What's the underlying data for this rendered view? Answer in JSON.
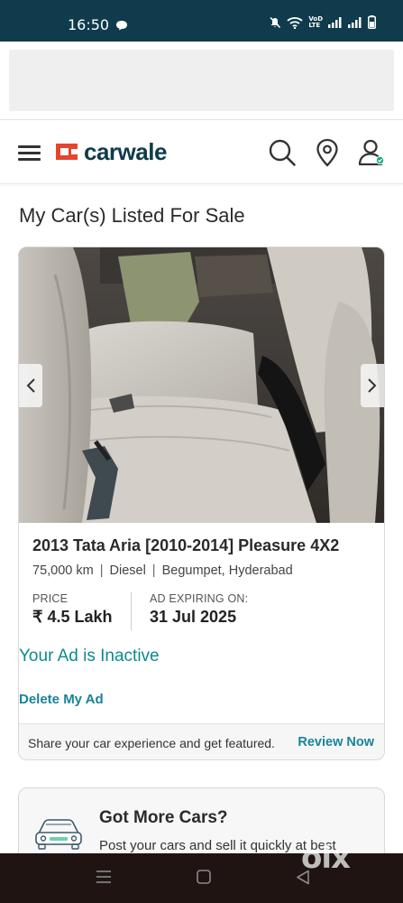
{
  "status_bar": {
    "time": "16:50",
    "network_label_top": "VoD",
    "network_label_bottom": "LTE"
  },
  "header": {
    "logo_text": "carwale",
    "brand_color": "#0f3b4c",
    "logo_accent_color": "#e5452d"
  },
  "page": {
    "title": "My Car(s) Listed For Sale"
  },
  "listing": {
    "title": "2013 Tata Aria [2010-2014] Pleasure 4X2",
    "specs": {
      "kms": "75,000 km",
      "fuel": "Diesel",
      "location": "Begumpet, Hyderabad",
      "separator": "|"
    },
    "price_label": "PRICE",
    "price_value": "₹ 4.5 Lakh",
    "expiry_label": "AD EXPIRING ON:",
    "expiry_value": "31 Jul 2025",
    "status_text": "Your Ad is Inactive",
    "status_color": "#0d8a8c",
    "delete_label": "Delete My Ad",
    "footer_text": "Share your car experience and get featured.",
    "review_label": "Review Now",
    "link_color": "#17849a"
  },
  "more_cars": {
    "title": "Got More Cars?",
    "subtitle": "Post your cars and sell it quickly at best"
  },
  "watermark": {
    "text": "olx"
  },
  "icons": {
    "menu": "hamburger-icon",
    "search": "search-icon",
    "location": "location-pin-icon",
    "account": "user-icon",
    "prev": "chevron-left-icon",
    "next": "chevron-right-icon"
  }
}
